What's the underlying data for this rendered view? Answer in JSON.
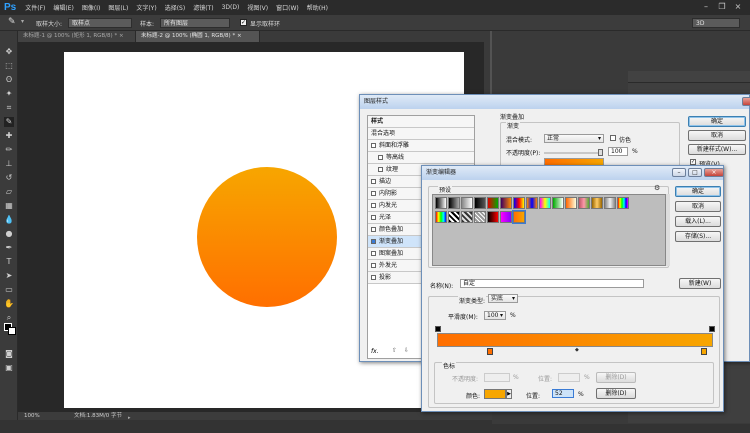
{
  "app": {
    "logo": "Ps"
  },
  "menu": [
    "文件(F)",
    "编辑(E)",
    "图像(I)",
    "图层(L)",
    "文字(Y)",
    "选择(S)",
    "滤镜(T)",
    "3D(D)",
    "视图(V)",
    "窗口(W)",
    "帮助(H)"
  ],
  "options": {
    "size_label": "取样大小:",
    "size_value": "取样点",
    "sample_label": "样本:",
    "sample_value": "所有图层",
    "ring_label": "显示取样环",
    "workspace": "3D"
  },
  "tabs": [
    {
      "label": "未标题-1 @ 100% (矩形 1, RGB/8) *",
      "close": "×"
    },
    {
      "label": "未标题-2 @ 100% (椭圆 1, RGB/8) *",
      "close": "×"
    }
  ],
  "status": {
    "zoom": "100%",
    "doc": "文档:1.83M/0 字节"
  },
  "colors": {
    "circle_top": "#f7a600",
    "circle_bottom": "#ff6f00",
    "gradient_left": "#ff6e00",
    "gradient_right": "#f7a600",
    "accent": "#2fa1ff"
  },
  "layer_style": {
    "title": "图层样式",
    "list": [
      "样式",
      "混合选项",
      "斜面和浮雕",
      "等高线",
      "纹理",
      "描边",
      "内阴影",
      "内发光",
      "光泽",
      "颜色叠加",
      "渐变叠加",
      "图案叠加",
      "外发光",
      "投影"
    ],
    "fx": "fx.",
    "section_title": "渐变叠加",
    "sub": "渐变",
    "blend_label": "混合模式:",
    "blend_value": "正常",
    "dither_label": "仿色",
    "opacity_label": "不透明度(P):",
    "opacity_value": "100",
    "pct": "%",
    "buttons": [
      "确定",
      "取消",
      "新建样式(W)...",
      "预览(V)"
    ]
  },
  "gradient_editor": {
    "title": "渐变编辑器",
    "presets_label": "预设",
    "buttons": [
      "确定",
      "取消",
      "载入(L)...",
      "存储(S)..."
    ],
    "name_label": "名称(N):",
    "name_value": "自定",
    "new_button": "新建(W)",
    "type_label": "渐变类型:",
    "type_value": "实底",
    "smooth_label": "平滑度(M):",
    "smooth_value": "100",
    "pct": "%",
    "stops_label": "色标",
    "s_opacity": "不透明度:",
    "s_loc1": "位置:",
    "s_del1": "删除(D)",
    "s_color": "颜色:",
    "s_loc2": "位置:",
    "s_loc2_value": "52",
    "s_del2": "删除(D)"
  }
}
